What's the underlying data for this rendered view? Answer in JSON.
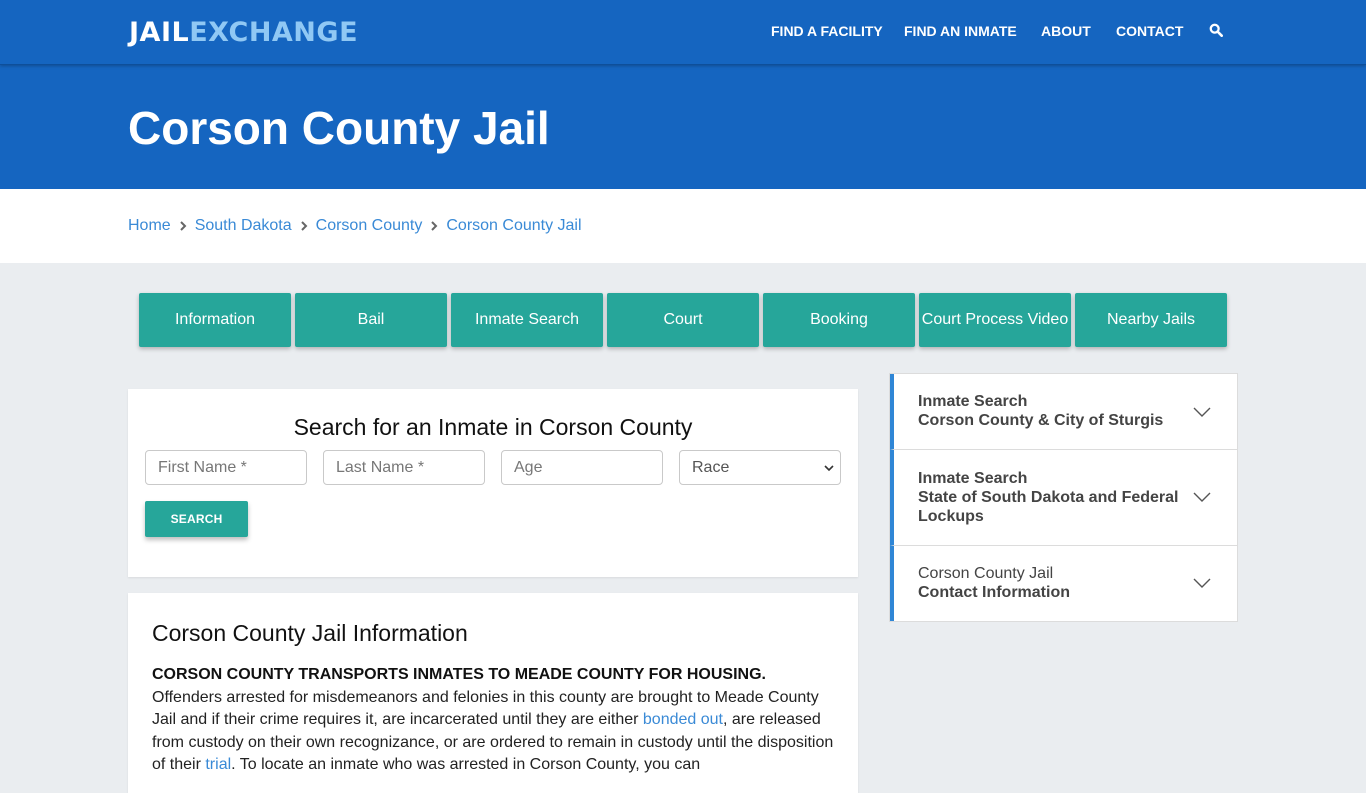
{
  "brand": {
    "logo_part1": "JAIL",
    "logo_part2": "EXCHANGE",
    "primary_color": "#1565c0",
    "accent_color": "#26a69a",
    "link_color": "#3a8ad6"
  },
  "nav": {
    "items": [
      {
        "label": "FIND A FACILITY"
      },
      {
        "label": "FIND AN INMATE"
      },
      {
        "label": "ABOUT"
      },
      {
        "label": "CONTACT"
      }
    ],
    "search_icon": "search-icon"
  },
  "page": {
    "title": "Corson County Jail"
  },
  "breadcrumb": [
    {
      "label": "Home"
    },
    {
      "label": "South Dakota"
    },
    {
      "label": "Corson County"
    },
    {
      "label": "Corson County Jail"
    }
  ],
  "tabs": [
    {
      "label": "Information"
    },
    {
      "label": "Bail"
    },
    {
      "label": "Inmate Search"
    },
    {
      "label": "Court"
    },
    {
      "label": "Booking"
    },
    {
      "label": "Court Process Video"
    },
    {
      "label": "Nearby Jails"
    }
  ],
  "search_form": {
    "title": "Search for an Inmate in Corson County",
    "first_name_placeholder": "First Name *",
    "last_name_placeholder": "Last Name *",
    "age_placeholder": "Age",
    "race_selected": "Race",
    "submit_label": "SEARCH"
  },
  "info": {
    "heading": "Corson County Jail Information",
    "lead_bold": "CORSON COUNTY TRANSPORTS INMATES TO MEADE COUNTY FOR HOUSING.",
    "text_1": " Offenders arrested for misdemeanors and felonies in this county are brought to Meade County Jail and if their crime requires it, are incarcerated until they are either ",
    "link_1": "bonded out",
    "text_2": ", are released from custody on their own recognizance, or are ordered to remain in custody until the disposition of their ",
    "link_2": "trial",
    "text_3": ". To locate an inmate who was arrested in Corson County, you can"
  },
  "sidebar": {
    "items": [
      {
        "line1": "Inmate Search",
        "line2": "Corson County & City of Sturgis",
        "line3": ""
      },
      {
        "line1": "Inmate Search",
        "line2": "State of South Dakota and Federal",
        "line3": "Lockups"
      },
      {
        "line1": "Corson County Jail",
        "line2": "Contact Information",
        "line3": ""
      }
    ]
  }
}
